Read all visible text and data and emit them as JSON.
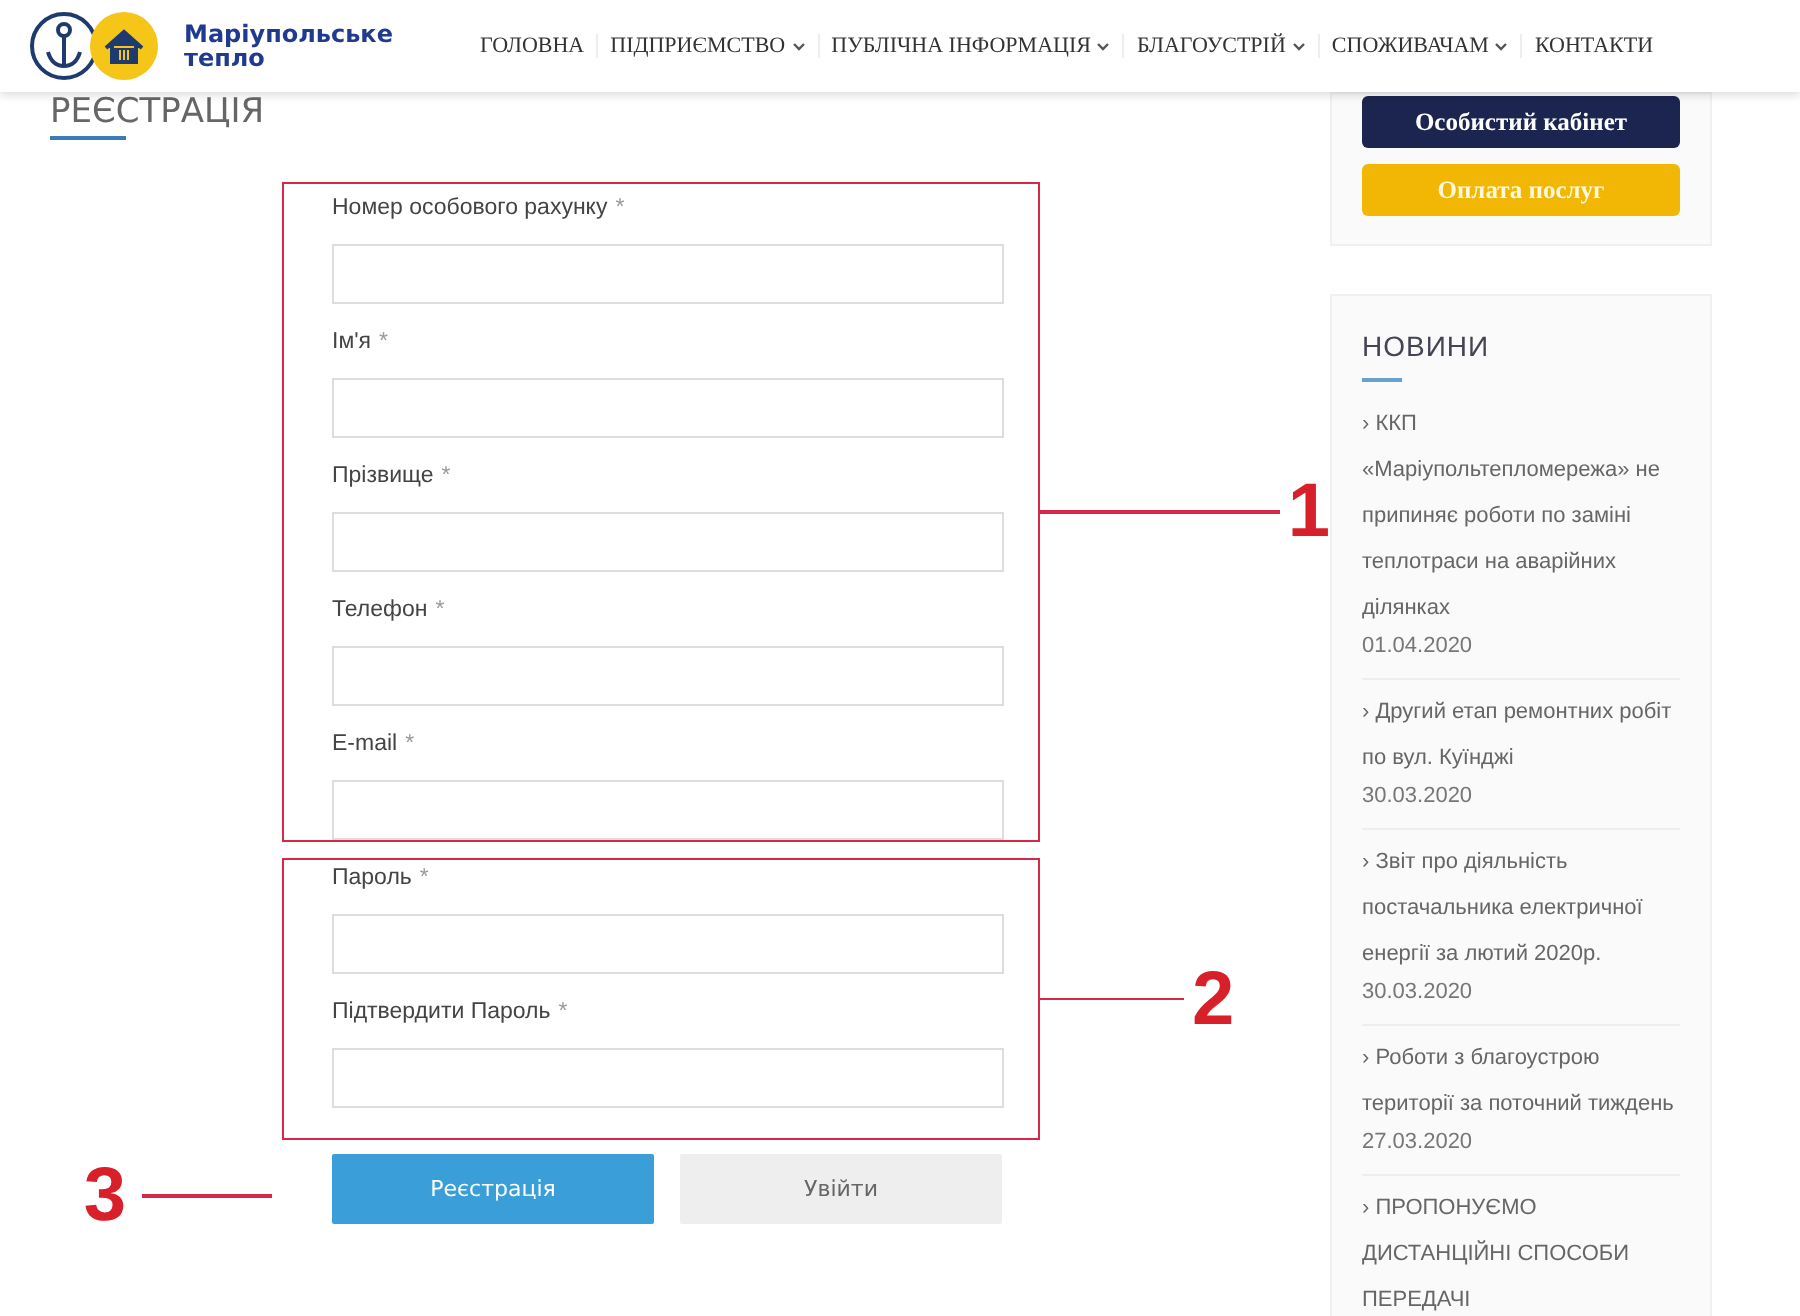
{
  "header": {
    "brand": [
      "Маріупольське",
      "тепло"
    ],
    "nav": [
      {
        "label": "ГОЛОВНА",
        "dropdown": false
      },
      {
        "label": "ПІДПРИЄМСТВО",
        "dropdown": true
      },
      {
        "label": "ПУБЛІЧНА ІНФОРМАЦІЯ",
        "dropdown": true
      },
      {
        "label": "БЛАГОУСТРІЙ",
        "dropdown": true
      },
      {
        "label": "СПОЖИВАЧАМ",
        "dropdown": true
      },
      {
        "label": "КОНТАКТИ",
        "dropdown": false
      }
    ]
  },
  "page_title": "РЕЄСТРАЦІЯ",
  "form": {
    "groups": [
      {
        "annotation": "1",
        "fields": [
          {
            "label": "Номер особового рахунку",
            "required_mark": "*"
          },
          {
            "label": "Ім'я",
            "required_mark": "*"
          },
          {
            "label": "Прізвище",
            "required_mark": "*"
          },
          {
            "label": "Телефон",
            "required_mark": "*"
          },
          {
            "label": "E-mail",
            "required_mark": "*"
          }
        ]
      },
      {
        "annotation": "2",
        "fields": [
          {
            "label": "Пароль",
            "required_mark": "*"
          },
          {
            "label": "Підтвердити Пароль",
            "required_mark": "*"
          }
        ]
      }
    ],
    "buttons": [
      {
        "label": "Реєстрація",
        "kind": "primary"
      },
      {
        "label": "Увійти",
        "kind": "secondary"
      }
    ],
    "buttons_annotation": "3"
  },
  "sidebar": {
    "buttons": [
      {
        "label": "Особистий кабінет",
        "kind": "dark"
      },
      {
        "label": "Оплата послуг",
        "kind": "yellow"
      }
    ],
    "news": {
      "title": "НОВИНИ",
      "items": [
        {
          "title": "› ККП «Маріупольтепломережа» не припиняє роботи по заміні теплотраси на аварійних ділянках",
          "date": "01.04.2020"
        },
        {
          "title": "› Другий етап ремонтних робіт по вул. Куїнджі",
          "date": "30.03.2020"
        },
        {
          "title": "› Звіт про діяльність постачальника електричної енергії за лютий 2020р.",
          "date": "30.03.2020"
        },
        {
          "title": "› Роботи з благоустрою території за поточний тиждень",
          "date": "27.03.2020"
        },
        {
          "title": "› ПРОПОНУЄМО ДИСТАНЦІЙНІ СПОСОБИ ПЕРЕДАЧІ"
        }
      ]
    }
  }
}
